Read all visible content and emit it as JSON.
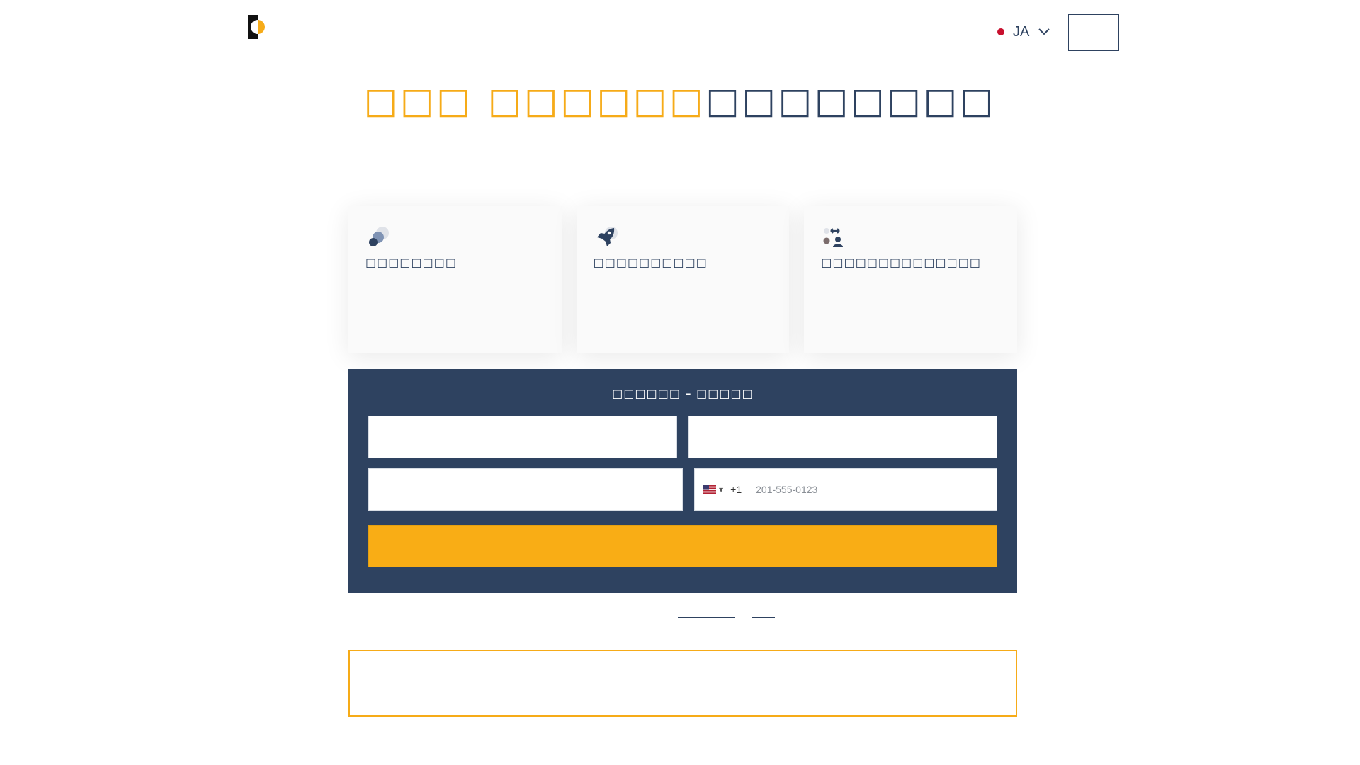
{
  "header": {
    "logo_icon": "half-circle-logo-icon",
    "language": {
      "code": "JA",
      "flag_color": "#c8102e"
    },
    "button_label": ""
  },
  "headline": {
    "accent_text": "□□□ □□□□□□",
    "dark_text": "□□□□□□□□",
    "accent_color": "#f6ab18",
    "dark_color": "#2e4260"
  },
  "features": [
    {
      "icon": "overlapping-circles-icon",
      "title": "□□□□□□□□"
    },
    {
      "icon": "rocket-icon",
      "title": "□□□□□□□□□□"
    },
    {
      "icon": "people-exchange-icon",
      "title": "□□□□□□□□□□□□□□"
    }
  ],
  "form": {
    "title": "□□□□□□ – □□□□□",
    "fields": [
      {
        "placeholder": "",
        "value": ""
      },
      {
        "placeholder": "",
        "value": ""
      },
      {
        "placeholder": "",
        "value": ""
      }
    ],
    "phone": {
      "country_flag": "us-flag-icon",
      "dial_code": "+1",
      "placeholder": "201-555-0123",
      "value": ""
    },
    "submit_label": "",
    "panel_color": "#2e4260",
    "button_color": "#f9ad15"
  },
  "links": [
    {
      "label": ""
    },
    {
      "label": ""
    }
  ],
  "bottom_box": {
    "text": "",
    "border_color": "#f6ab18"
  }
}
